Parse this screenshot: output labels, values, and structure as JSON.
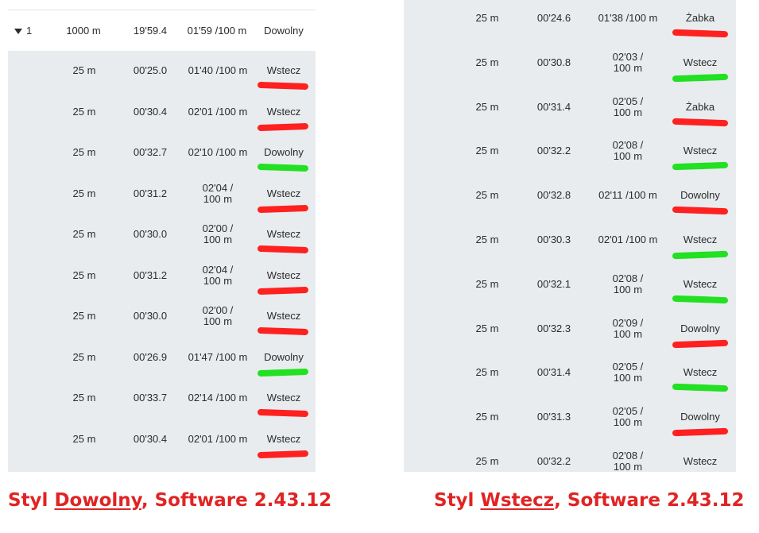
{
  "left": {
    "lap": {
      "index": "1",
      "distance": "1000 m",
      "time": "19'59.4",
      "pace": "01'59 /100 m",
      "style": "Dowolny"
    },
    "lengths": [
      {
        "distance": "25 m",
        "time": "00'25.0",
        "pace": "01'40 /100 m",
        "style": "Wstecz",
        "mark": "red"
      },
      {
        "distance": "25 m",
        "time": "00'30.4",
        "pace": "02'01 /100 m",
        "style": "Wstecz",
        "mark": "red"
      },
      {
        "distance": "25 m",
        "time": "00'32.7",
        "pace": "02'10 /100 m",
        "style": "Dowolny",
        "mark": "green"
      },
      {
        "distance": "25 m",
        "time": "00'31.2",
        "pace": "02'04 / 100 m",
        "style": "Wstecz",
        "mark": "red"
      },
      {
        "distance": "25 m",
        "time": "00'30.0",
        "pace": "02'00 / 100 m",
        "style": "Wstecz",
        "mark": "red"
      },
      {
        "distance": "25 m",
        "time": "00'31.2",
        "pace": "02'04 / 100 m",
        "style": "Wstecz",
        "mark": "red"
      },
      {
        "distance": "25 m",
        "time": "00'30.0",
        "pace": "02'00 / 100 m",
        "style": "Wstecz",
        "mark": "red"
      },
      {
        "distance": "25 m",
        "time": "00'26.9",
        "pace": "01'47 /100 m",
        "style": "Dowolny",
        "mark": "green"
      },
      {
        "distance": "25 m",
        "time": "00'33.7",
        "pace": "02'14 /100 m",
        "style": "Wstecz",
        "mark": "red"
      },
      {
        "distance": "25 m",
        "time": "00'30.4",
        "pace": "02'01 /100 m",
        "style": "Wstecz",
        "mark": "red"
      }
    ],
    "caption": {
      "prefix": "Styl ",
      "style": "Dowolny",
      "suffix": ", Software 2.43.12"
    }
  },
  "right": {
    "lengths": [
      {
        "distance": "25 m",
        "time": "00'24.6",
        "pace": "01'38 /100 m",
        "style": "Żabka",
        "mark": "red"
      },
      {
        "distance": "25 m",
        "time": "00'30.8",
        "pace": "02'03 / 100 m",
        "style": "Wstecz",
        "mark": "green"
      },
      {
        "distance": "25 m",
        "time": "00'31.4",
        "pace": "02'05 / 100 m",
        "style": "Żabka",
        "mark": "red"
      },
      {
        "distance": "25 m",
        "time": "00'32.2",
        "pace": "02'08 / 100 m",
        "style": "Wstecz",
        "mark": "green"
      },
      {
        "distance": "25 m",
        "time": "00'32.8",
        "pace": "02'11 /100 m",
        "style": "Dowolny",
        "mark": "red"
      },
      {
        "distance": "25 m",
        "time": "00'30.3",
        "pace": "02'01 /100 m",
        "style": "Wstecz",
        "mark": "green"
      },
      {
        "distance": "25 m",
        "time": "00'32.1",
        "pace": "02'08 / 100 m",
        "style": "Wstecz",
        "mark": "green"
      },
      {
        "distance": "25 m",
        "time": "00'32.3",
        "pace": "02'09 / 100 m",
        "style": "Dowolny",
        "mark": "red"
      },
      {
        "distance": "25 m",
        "time": "00'31.4",
        "pace": "02'05 / 100 m",
        "style": "Wstecz",
        "mark": "green"
      },
      {
        "distance": "25 m",
        "time": "00'31.3",
        "pace": "02'05 / 100 m",
        "style": "Dowolny",
        "mark": "red"
      },
      {
        "distance": "25 m",
        "time": "00'32.2",
        "pace": "02'08 / 100 m",
        "style": "Wstecz",
        "mark": "green"
      }
    ],
    "caption": {
      "prefix": "Styl ",
      "style": "Wstecz",
      "suffix": ", Software 2.43.12"
    }
  },
  "colors": {
    "red_mark": "#ff2020",
    "green_mark": "#22e022",
    "caption": "#e02424",
    "row_bg": "#e8ecee"
  }
}
